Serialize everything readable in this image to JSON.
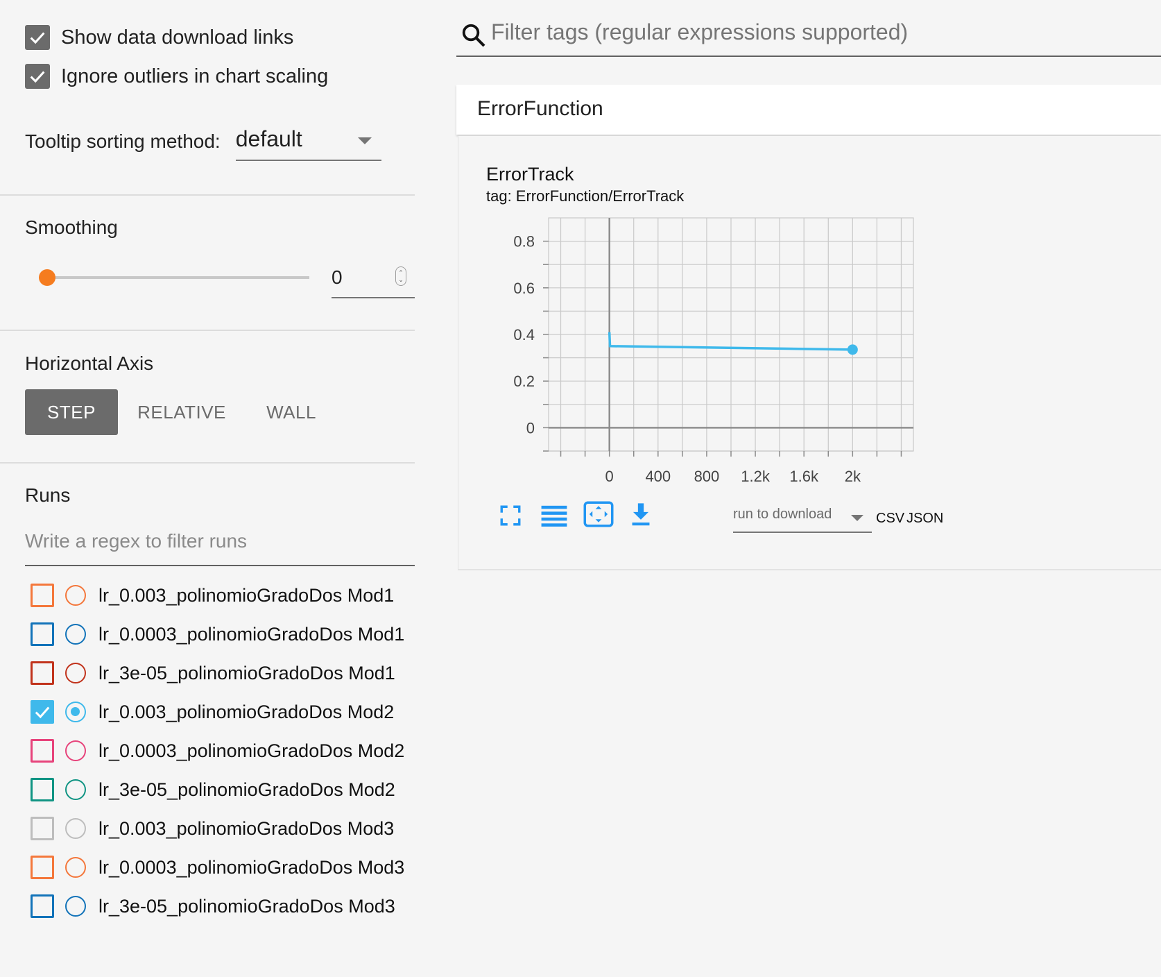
{
  "sidebar": {
    "show_download_links": {
      "label": "Show data download links",
      "checked": true
    },
    "ignore_outliers": {
      "label": "Ignore outliers in chart scaling",
      "checked": true
    },
    "tooltip": {
      "label": "Tooltip sorting method:",
      "value": "default"
    },
    "smoothing": {
      "title": "Smoothing",
      "value": "0",
      "slider_fraction": 0
    },
    "horizontal_axis": {
      "title": "Horizontal Axis",
      "options": [
        "STEP",
        "RELATIVE",
        "WALL"
      ],
      "selected": "STEP"
    },
    "runs": {
      "title": "Runs",
      "filter_placeholder": "Write a regex to filter runs",
      "items": [
        {
          "label": "lr_0.003_polinomioGradoDos Mod1",
          "color": "#f4773b",
          "checked": false
        },
        {
          "label": "lr_0.0003_polinomioGradoDos Mod1",
          "color": "#1273b9",
          "checked": false
        },
        {
          "label": "lr_3e-05_polinomioGradoDos Mod1",
          "color": "#c1331c",
          "checked": false
        },
        {
          "label": "lr_0.003_polinomioGradoDos Mod2",
          "color": "#3fb9eb",
          "checked": true
        },
        {
          "label": "lr_0.0003_polinomioGradoDos Mod2",
          "color": "#e7437b",
          "checked": false
        },
        {
          "label": "lr_3e-05_polinomioGradoDos Mod2",
          "color": "#109483",
          "checked": false
        },
        {
          "label": "lr_0.003_polinomioGradoDos Mod3",
          "color": "#bdbdbd",
          "checked": false
        },
        {
          "label": "lr_0.0003_polinomioGradoDos Mod3",
          "color": "#f4773b",
          "checked": false
        },
        {
          "label": "lr_3e-05_polinomioGradoDos Mod3",
          "color": "#1273b9",
          "checked": false
        }
      ]
    }
  },
  "main": {
    "search_placeholder": "Filter tags (regular expressions supported)",
    "group_title": "ErrorFunction",
    "card": {
      "title": "ErrorTrack",
      "tag": "tag: ErrorFunction/ErrorTrack",
      "run_select_placeholder": "run to download",
      "download_links": [
        "CSV",
        "JSON"
      ],
      "icons": [
        "fullscreen-icon",
        "toggle-log-scale-icon",
        "fit-domain-icon",
        "download-icon"
      ]
    }
  },
  "chart_data": {
    "type": "line",
    "title": "ErrorTrack",
    "xlabel": "",
    "ylabel": "",
    "xlim": [
      -500,
      2500
    ],
    "ylim": [
      -0.1,
      0.9
    ],
    "x_ticks": [
      0,
      400,
      800,
      1200,
      1600,
      2000
    ],
    "x_tick_labels": [
      "0",
      "400",
      "800",
      "1.2k",
      "1.6k",
      "2k"
    ],
    "y_ticks": [
      0,
      0.2,
      0.4,
      0.6,
      0.8
    ],
    "y_tick_labels": [
      "0",
      "0.2",
      "0.4",
      "0.6",
      "0.8"
    ],
    "grid": true,
    "series": [
      {
        "color": "#3fb9eb",
        "x": [
          0,
          5,
          10,
          2000
        ],
        "y": [
          0.41,
          0.35,
          0.35,
          0.335
        ]
      }
    ]
  }
}
